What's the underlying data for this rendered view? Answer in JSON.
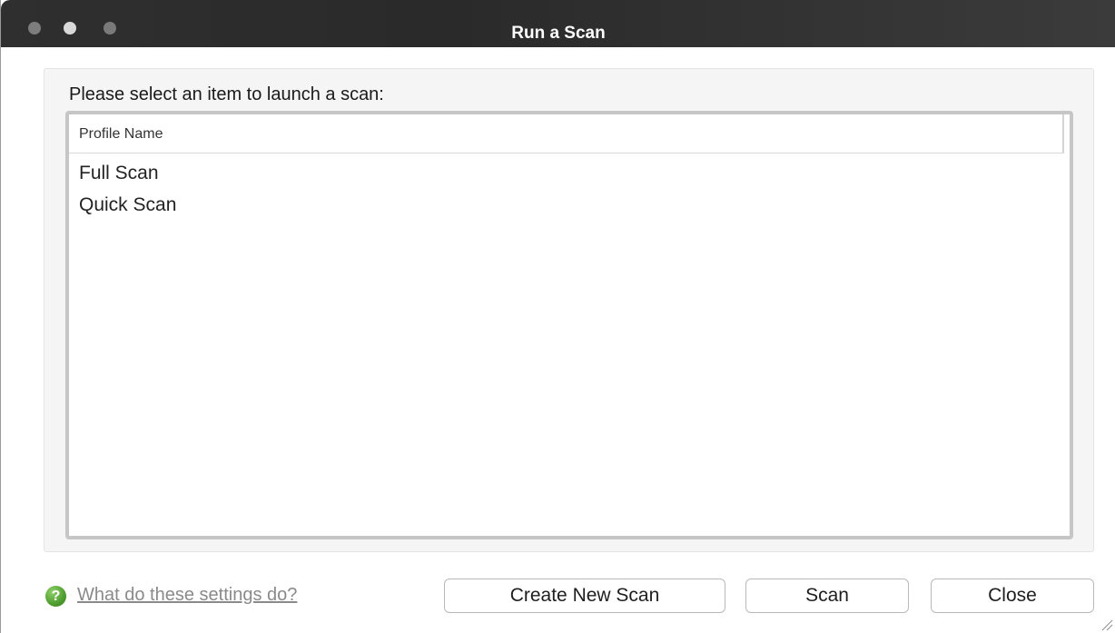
{
  "window": {
    "title": "Run a Scan"
  },
  "prompt": "Please select an item to launch a scan:",
  "list": {
    "column_header": "Profile Name",
    "items": [
      "Full Scan",
      "Quick Scan"
    ]
  },
  "footer": {
    "help_link": "What do these settings do?",
    "help_icon": "question-icon",
    "buttons": {
      "create": "Create New Scan",
      "scan": "Scan",
      "close": "Close"
    }
  },
  "colors": {
    "titlebar": "#2f2f2f",
    "help_icon": "#4e9d2d",
    "link": "#8a8a8a"
  }
}
